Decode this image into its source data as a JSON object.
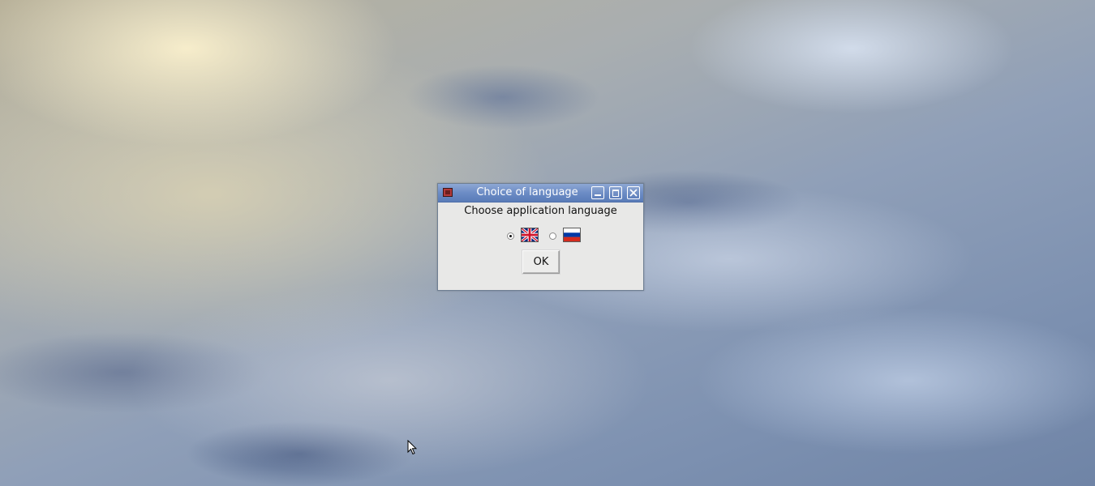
{
  "desktop": {
    "wallpaper": "clouds"
  },
  "dialog": {
    "title": "Choice of language",
    "app_icon": "tk-app-icon",
    "controls": {
      "minimize": "minimize-icon",
      "maximize": "maximize-icon",
      "close": "close-icon"
    },
    "prompt": "Choose application language",
    "options": [
      {
        "language": "English",
        "flag": "uk-flag-icon",
        "selected": true
      },
      {
        "language": "Russian",
        "flag": "russia-flag-icon",
        "selected": false
      }
    ],
    "ok_label": "OK"
  },
  "colors": {
    "titlebar": "#6c8cc5",
    "dialog_bg": "#e8e8e7",
    "flag_red": "#cf142b",
    "flag_blue": "#00247d",
    "ru_blue": "#0039a6",
    "ru_red": "#d52b1e"
  }
}
